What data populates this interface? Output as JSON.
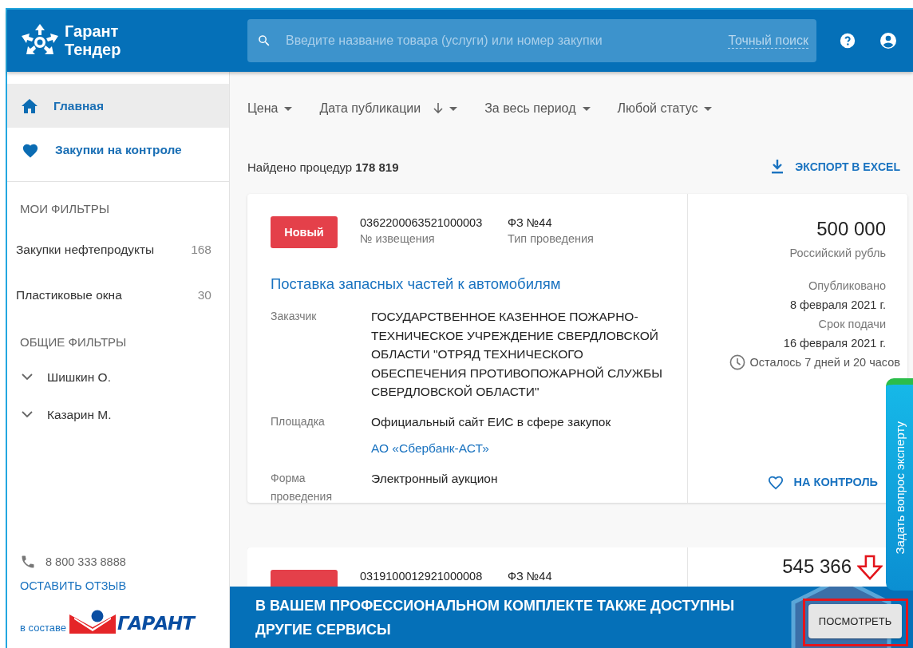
{
  "header": {
    "logo": {
      "line_1": "Гарант",
      "line_2": "Тендер"
    },
    "search": {
      "placeholder": "Введите название товара (услуги) или номер закупки",
      "exact_search_link": "Точный поиск"
    }
  },
  "sidebar": {
    "nav": [
      {
        "label": "Главная",
        "selected": true
      },
      {
        "label": "Закупки на контроле",
        "selected": false
      }
    ],
    "my_filters": {
      "title": "МОИ ФИЛЬТРЫ",
      "items": [
        {
          "label": "Закупки нефтепродукты",
          "count": "168"
        },
        {
          "label": "Пластиковые окна",
          "count": "30"
        }
      ]
    },
    "shared_filters": {
      "title": "ОБЩИЕ ФИЛЬТРЫ",
      "items": [
        {
          "label": "Шишкин О.",
          "expanded": false
        },
        {
          "label": "Казарин М.",
          "expanded": false
        }
      ]
    },
    "phone": "8 800 333 8888",
    "feedback_link": "ОСТАВИТЬ ОТЗЫВ",
    "part_of_label": "в составе",
    "brand_logo_text": "ГАРАНТ"
  },
  "filters": [
    {
      "label": "Цена",
      "kind": "plain"
    },
    {
      "label": "Дата публикации",
      "kind": "sort"
    },
    {
      "label": "За весь период",
      "kind": "plain"
    },
    {
      "label": "Любой статус",
      "kind": "plain"
    }
  ],
  "results": {
    "found_label": "Найдено процедур",
    "count": "178 819",
    "export_link": "ЭКСПОРТ В EXCEL"
  },
  "cards": [
    {
      "status": "Новый",
      "notice_number": "0362200063521000003",
      "notice_label": "№ извещения",
      "law": "ФЗ №44",
      "law_label": "Тип проведения",
      "title": "Поставка запасных частей к автомобилям",
      "fields": [
        {
          "label": "Заказчик",
          "values": [
            {
              "text": "ГОСУДАРСТВЕННОЕ КАЗЕННОЕ ПОЖАРНО-ТЕХНИЧЕСКОЕ УЧРЕЖДЕНИЕ СВЕРДЛОВСКОЙ ОБЛАСТИ \"ОТРЯД ТЕХНИЧЕСКОГО ОБЕСПЕЧЕНИЯ ПРОТИВОПОЖАРНОЙ СЛУЖБЫ СВЕРДЛОВСКОЙ ОБЛАСТИ\"",
              "kind": "text"
            }
          ]
        },
        {
          "label": "Площадка",
          "values": [
            {
              "text": "Официальный сайт ЕИС в сфере закупок",
              "kind": "text"
            },
            {
              "text": "АО «Сбербанк-АСТ»",
              "kind": "link"
            }
          ]
        },
        {
          "label": "Форма проведения",
          "values": [
            {
              "text": "Электронный аукцион",
              "kind": "text"
            }
          ]
        }
      ],
      "price": "500 000",
      "currency": "Российский рубль",
      "published_label": "Опубликовано",
      "published_date": "8 февраля 2021 г.",
      "deadline_label": "Срок подачи",
      "deadline_date": "16 февраля 2021 г.",
      "remaining": "Осталось 7 дней и 20 часов",
      "watch_button": "НА КОНТРОЛЬ"
    },
    {
      "notice_number": "0319100012921000008",
      "law": "ФЗ №44",
      "price": "545 366"
    }
  ],
  "banner": {
    "text": "В ВАШЕМ ПРОФЕССИОНАЛЬНОМ КОМПЛЕКТЕ ТАКЖЕ ДОСТУПНЫ ДРУГИЕ СЕРВИСЫ",
    "button": "ПОСМОТРЕТЬ"
  },
  "expert_tab": "Задать вопрос эксперту"
}
